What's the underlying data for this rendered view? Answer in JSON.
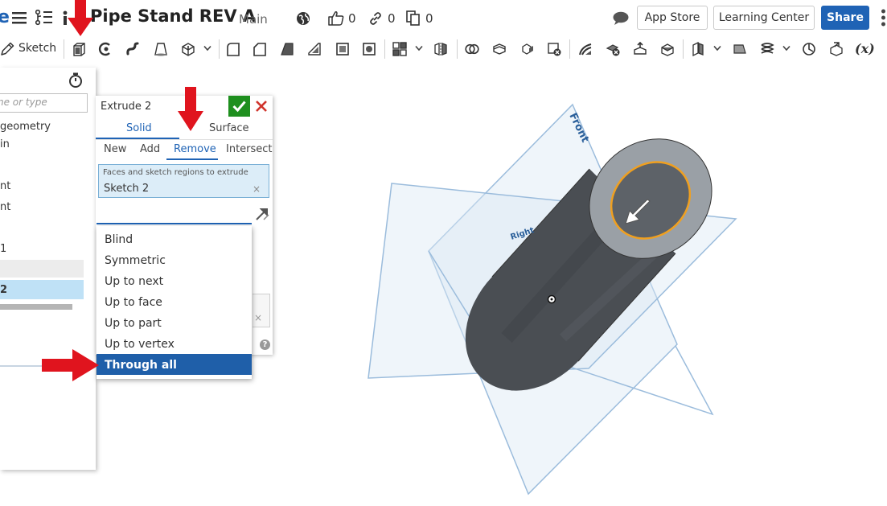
{
  "header": {
    "logo_fragment": "e",
    "document_title": "Pipe Stand REV A",
    "workspace": "Main",
    "likes_count": "0",
    "links_count": "0",
    "copies_count": "0",
    "app_store_label": "App Store",
    "learning_center_label": "Learning Center",
    "share_label": "Share"
  },
  "toolbar": {
    "sketch_label": "Sketch",
    "variable_label": "(x)"
  },
  "feature_list": {
    "filter_placeholder": "ne or type",
    "items": [
      "geometry",
      "in",
      "nt",
      "nt",
      "1",
      "2"
    ]
  },
  "extrude": {
    "title": "Extrude 2",
    "body_tabs": [
      "Solid",
      "Surface"
    ],
    "operation_tabs": [
      "New",
      "Add",
      "Remove",
      "Intersect"
    ],
    "active_body_tab": "Solid",
    "active_operation": "Remove",
    "faces_label": "Faces and sketch regions to extrude",
    "faces_value": "Sketch 2",
    "clear_glyph": "×",
    "help_glyph": "?"
  },
  "end_type_dropdown": {
    "options": [
      "Blind",
      "Symmetric",
      "Up to next",
      "Up to face",
      "Up to part",
      "Up to vertex",
      "Through all"
    ],
    "selected": "Through all"
  },
  "viewport": {
    "front_plane_label": "Front",
    "right_plane_label": "Right"
  },
  "colors": {
    "accent_blue": "#1f63b5",
    "ok_green": "#1e8f1e",
    "cancel_red": "#d0342c",
    "annotation_red": "#e0141e",
    "plane_blue": "#9bbcdc",
    "cylinder_dark": "#4a4e53",
    "cylinder_face": "#9aa0a6",
    "selection_orange": "#f0a020"
  }
}
